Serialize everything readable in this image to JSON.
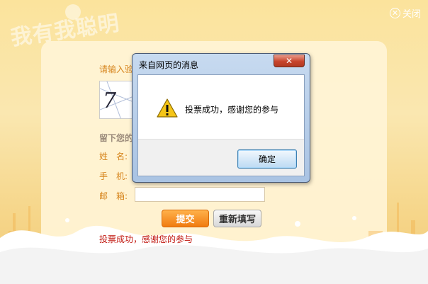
{
  "page": {
    "bg_title": "我有我聪明",
    "close_label": "关闭"
  },
  "form": {
    "captcha_prompt": "请输入验",
    "captcha_text": "7",
    "section_label": "留下您的",
    "name_label": "姓　名:",
    "phone_label": "手　机:",
    "email_label": "邮　箱:",
    "submit_label": "提交",
    "reset_label": "重新填写",
    "result_message": "投票成功，感谢您的参与"
  },
  "dialog": {
    "title": "来自网页的消息",
    "close_glyph": "✕",
    "message": "投票成功，感谢您的参与",
    "ok_label": "确定"
  },
  "colors": {
    "accent_orange": "#f07b10",
    "label_orange": "#d6831a",
    "result_red": "#c0140c",
    "dialog_frame": "#a9c3e3"
  }
}
